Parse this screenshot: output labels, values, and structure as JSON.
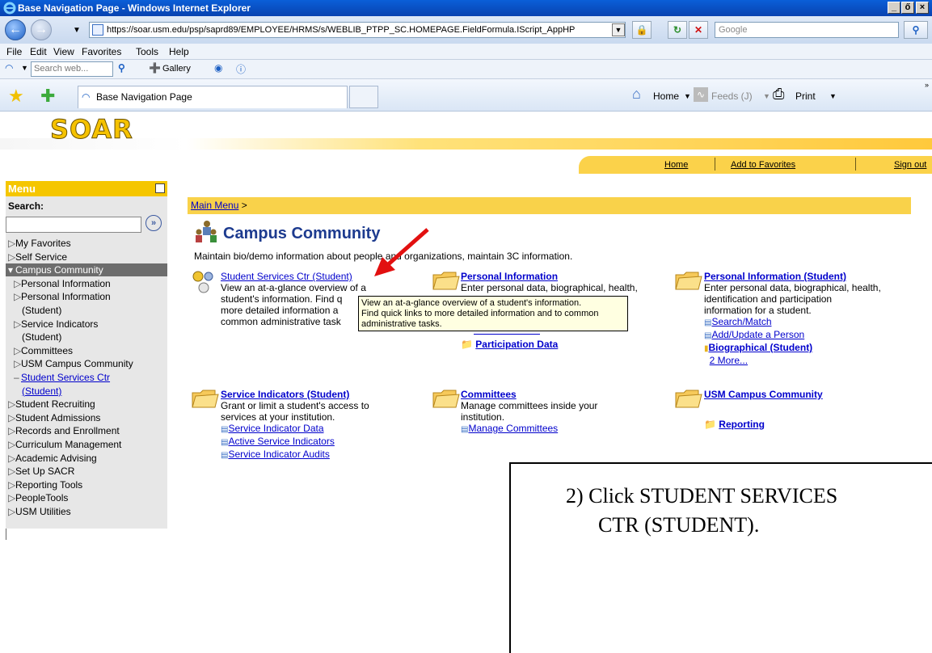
{
  "window": {
    "title": "Base Navigation Page - Windows Internet Explorer",
    "controls": [
      "_",
      "ő",
      "×"
    ]
  },
  "address": {
    "url": "https://soar.usm.edu/psp/saprd89/EMPLOYEE/HRMS/s/WEBLIB_PTPP_SC.HOMEPAGE.FieldFormula.IScript_AppHP",
    "search_placeholder": "Google"
  },
  "menubar": {
    "items": [
      "File",
      "Edit",
      "View",
      "Favorites",
      "Tools",
      "Help"
    ]
  },
  "toolbar": {
    "search_placeholder": "Search web...",
    "gallery": "Gallery"
  },
  "tabs": {
    "active": "Base Navigation Page"
  },
  "commandbar": {
    "home": "Home",
    "feeds": "Feeds (J)",
    "print": "Print"
  },
  "soar": {
    "logo": "SOAR",
    "links": [
      "Home",
      "Add to Favorites",
      "Sign out"
    ]
  },
  "leftmenu": {
    "title": "Menu",
    "search_label": "Search:",
    "items": [
      {
        "label": "My Favorites",
        "type": "top"
      },
      {
        "label": "Self Service",
        "type": "top"
      },
      {
        "label": "Campus Community",
        "type": "selected"
      },
      {
        "label": "Personal Information",
        "type": "sub"
      },
      {
        "label": "Personal Information",
        "type": "sub"
      },
      {
        "label": "(Student)",
        "type": "cont"
      },
      {
        "label": "Service Indicators",
        "type": "sub"
      },
      {
        "label": "(Student)",
        "type": "cont"
      },
      {
        "label": "Committees",
        "type": "sub"
      },
      {
        "label": "USM Campus Community",
        "type": "sub"
      },
      {
        "label": "Student Services Ctr",
        "type": "link"
      },
      {
        "label": "(Student)",
        "type": "linkcont"
      },
      {
        "label": "Student Recruiting",
        "type": "top"
      },
      {
        "label": "Student Admissions",
        "type": "top"
      },
      {
        "label": "Records and Enrollment",
        "type": "top"
      },
      {
        "label": "Curriculum Management",
        "type": "top"
      },
      {
        "label": "Academic Advising",
        "type": "top"
      },
      {
        "label": "Set Up SACR",
        "type": "top"
      },
      {
        "label": "Reporting Tools",
        "type": "top"
      },
      {
        "label": "PeopleTools",
        "type": "top"
      },
      {
        "label": "USM Utilities",
        "type": "top"
      }
    ]
  },
  "main": {
    "breadcrumb": "Main Menu",
    "breadcrumb_sep": " >",
    "title": "Campus Community",
    "description": "Maintain bio/demo information about people and organizations, maintain 3C information.",
    "ssc": {
      "title": "Student Services Ctr (Student)",
      "desc": [
        "View an at-a-glance overview of a",
        "student's information. Find q",
        "more detailed information a",
        "common administrative task"
      ]
    },
    "pi": {
      "title": "Personal Information",
      "desc": [
        "Enter personal data, biographical, health,"
      ],
      "link": "Participation Data"
    },
    "pis": {
      "title": "Personal Information (Student)",
      "desc": [
        "Enter personal data, biographical, health,",
        "identification and participation",
        "information for a student."
      ],
      "links": [
        "Search/Match",
        "Add/Update a Person",
        "Biographical (Student)"
      ],
      "more": "2 More..."
    },
    "si": {
      "title": "Service Indicators (Student)",
      "desc": [
        "Grant or limit a student's access to",
        "services at your institution."
      ],
      "links": [
        "Service Indicator Data",
        "Active Service Indicators",
        "Service Indicator Audits"
      ]
    },
    "cm": {
      "title": "Committees",
      "desc": [
        "Manage committees inside your",
        "institution."
      ],
      "link": "Manage Committees"
    },
    "usm": {
      "title": "USM Campus Community",
      "link": "Reporting"
    },
    "tooltip": [
      "View an at-a-glance overview of a student's information.",
      "Find quick links to more detailed information and to common",
      "administrative tasks."
    ]
  },
  "instruction": {
    "line1": "2)  Click STUDENT SERVICES",
    "line2": "CTR (STUDENT)."
  },
  "colors": {
    "accent": "#f5c600",
    "link": "#0000cc",
    "title_blue": "#1d3b8f",
    "tooltip_bg": "#ffffe1"
  }
}
